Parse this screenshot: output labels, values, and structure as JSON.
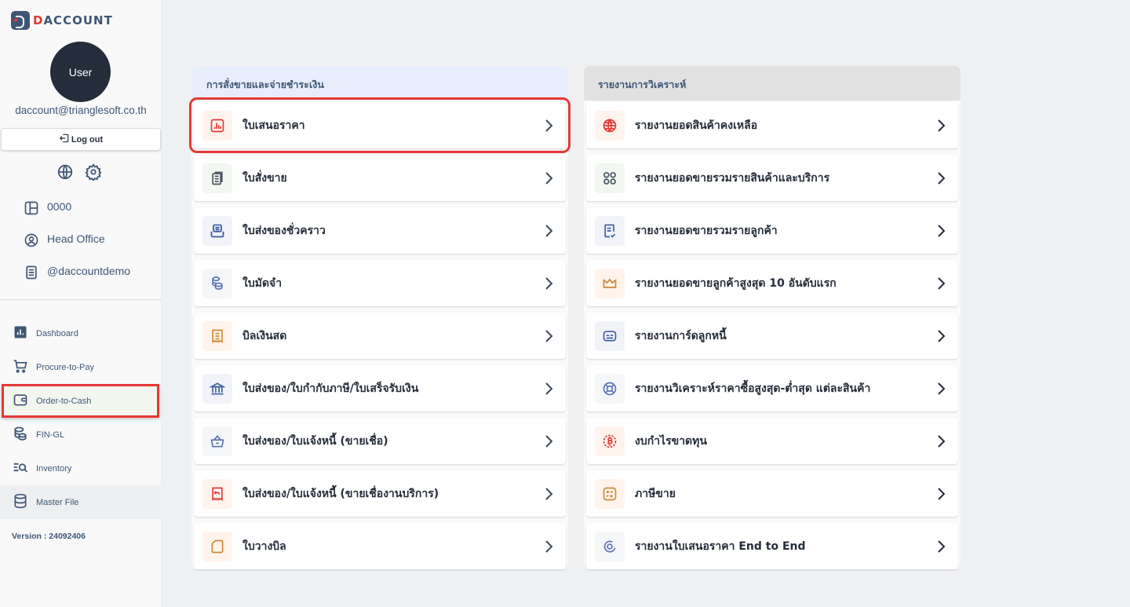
{
  "brand": {
    "logo_text_accent": "D",
    "logo_text_rest": "ACCOUNT",
    "accent_color": "#e53935",
    "primary_color": "#3e5776"
  },
  "user": {
    "avatar_label": "User",
    "email": "daccount@trianglesoft.co.th",
    "logout_label": "Log out"
  },
  "info": {
    "company_code": "0000",
    "branch": "Head Office",
    "account": "@daccountdemo"
  },
  "nav": {
    "items": [
      {
        "label": "Dashboard",
        "icon": "chart-bar-icon"
      },
      {
        "label": "Procure-to-Pay",
        "icon": "cart-icon"
      },
      {
        "label": "Order-to-Cash",
        "icon": "wallet-icon",
        "active": true
      },
      {
        "label": "FIN-GL",
        "icon": "coins-icon"
      },
      {
        "label": "Inventory",
        "icon": "list-search-icon"
      },
      {
        "label": "Master File",
        "icon": "database-icon"
      }
    ]
  },
  "version_label": "Version : 24092406",
  "panels": [
    {
      "title": "การสั่งขายและจ่ายชำระเงิน",
      "items": [
        {
          "label": "ใบเสนอราคา",
          "icon": "chart-report-icon",
          "selected": true
        },
        {
          "label": "ใบสั่งขาย",
          "icon": "documents-icon"
        },
        {
          "label": "ใบส่งของชั่วคราว",
          "icon": "inbox-icon"
        },
        {
          "label": "ใบมัดจำ",
          "icon": "coins-icon"
        },
        {
          "label": "บิลเงินสด",
          "icon": "receipt-icon"
        },
        {
          "label": "ใบส่งของ/ใบกำกับภาษี/ใบเสร็จรับเงิน",
          "icon": "bank-icon"
        },
        {
          "label": "ใบส่งของ/ใบแจ้งหนี้ (ขายเชื่อ)",
          "icon": "basket-icon"
        },
        {
          "label": "ใบส่งของ/ใบแจ้งหนี้ (ขายเชื่องานบริการ)",
          "icon": "receipt-return-icon"
        },
        {
          "label": "ใบวางบิล",
          "icon": "card-outline-icon"
        }
      ]
    },
    {
      "title": "รายงานการวิเคราะห์",
      "items": [
        {
          "label": "รายงานยอดสินค้าคงเหลือ",
          "icon": "globe-icon"
        },
        {
          "label": "รายงานยอดขายรวมรายสินค้าและบริการ",
          "icon": "grid-circles-icon"
        },
        {
          "label": "รายงานยอดขายรวมรายลูกค้า",
          "icon": "checklist-icon"
        },
        {
          "label": "รายงานยอดขายลูกค้าสูงสุด 10 อันดับแรก",
          "icon": "crown-icon"
        },
        {
          "label": "รายงานการ์ดลูกหนี้",
          "icon": "card-icon"
        },
        {
          "label": "รายงานวิเคราะห์ราคาซื้อสูงสุด-ต่ำสุด แต่ละสินค้า",
          "icon": "lifebuoy-icon"
        },
        {
          "label": "งบกำไรขาดทุน",
          "icon": "bitcoin-icon"
        },
        {
          "label": "ภาษีขาย",
          "icon": "calculator-icon"
        },
        {
          "label": "รายงานใบเสนอราคา End to End",
          "icon": "target-icon"
        }
      ]
    }
  ]
}
